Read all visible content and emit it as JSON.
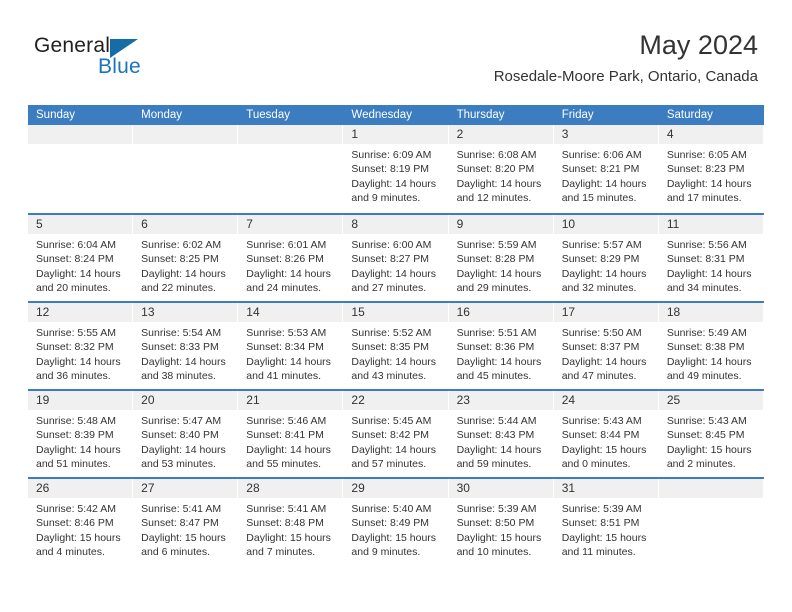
{
  "brand": {
    "name_part1": "General",
    "name_part2": "Blue",
    "accent_color": "#1b75bb",
    "triangle_color": "#166ca7"
  },
  "header": {
    "title": "May 2024",
    "subtitle": "Rosedale-Moore Park, Ontario, Canada"
  },
  "calendar": {
    "header_color": "#3b7dc0",
    "weekdays": [
      "Sunday",
      "Monday",
      "Tuesday",
      "Wednesday",
      "Thursday",
      "Friday",
      "Saturday"
    ],
    "weeks": [
      [
        {
          "day": "",
          "sunrise": "",
          "sunset": "",
          "daylight_line1": "",
          "daylight_line2": ""
        },
        {
          "day": "",
          "sunrise": "",
          "sunset": "",
          "daylight_line1": "",
          "daylight_line2": ""
        },
        {
          "day": "",
          "sunrise": "",
          "sunset": "",
          "daylight_line1": "",
          "daylight_line2": ""
        },
        {
          "day": "1",
          "sunrise": "Sunrise: 6:09 AM",
          "sunset": "Sunset: 8:19 PM",
          "daylight_line1": "Daylight: 14 hours",
          "daylight_line2": "and 9 minutes."
        },
        {
          "day": "2",
          "sunrise": "Sunrise: 6:08 AM",
          "sunset": "Sunset: 8:20 PM",
          "daylight_line1": "Daylight: 14 hours",
          "daylight_line2": "and 12 minutes."
        },
        {
          "day": "3",
          "sunrise": "Sunrise: 6:06 AM",
          "sunset": "Sunset: 8:21 PM",
          "daylight_line1": "Daylight: 14 hours",
          "daylight_line2": "and 15 minutes."
        },
        {
          "day": "4",
          "sunrise": "Sunrise: 6:05 AM",
          "sunset": "Sunset: 8:23 PM",
          "daylight_line1": "Daylight: 14 hours",
          "daylight_line2": "and 17 minutes."
        }
      ],
      [
        {
          "day": "5",
          "sunrise": "Sunrise: 6:04 AM",
          "sunset": "Sunset: 8:24 PM",
          "daylight_line1": "Daylight: 14 hours",
          "daylight_line2": "and 20 minutes."
        },
        {
          "day": "6",
          "sunrise": "Sunrise: 6:02 AM",
          "sunset": "Sunset: 8:25 PM",
          "daylight_line1": "Daylight: 14 hours",
          "daylight_line2": "and 22 minutes."
        },
        {
          "day": "7",
          "sunrise": "Sunrise: 6:01 AM",
          "sunset": "Sunset: 8:26 PM",
          "daylight_line1": "Daylight: 14 hours",
          "daylight_line2": "and 24 minutes."
        },
        {
          "day": "8",
          "sunrise": "Sunrise: 6:00 AM",
          "sunset": "Sunset: 8:27 PM",
          "daylight_line1": "Daylight: 14 hours",
          "daylight_line2": "and 27 minutes."
        },
        {
          "day": "9",
          "sunrise": "Sunrise: 5:59 AM",
          "sunset": "Sunset: 8:28 PM",
          "daylight_line1": "Daylight: 14 hours",
          "daylight_line2": "and 29 minutes."
        },
        {
          "day": "10",
          "sunrise": "Sunrise: 5:57 AM",
          "sunset": "Sunset: 8:29 PM",
          "daylight_line1": "Daylight: 14 hours",
          "daylight_line2": "and 32 minutes."
        },
        {
          "day": "11",
          "sunrise": "Sunrise: 5:56 AM",
          "sunset": "Sunset: 8:31 PM",
          "daylight_line1": "Daylight: 14 hours",
          "daylight_line2": "and 34 minutes."
        }
      ],
      [
        {
          "day": "12",
          "sunrise": "Sunrise: 5:55 AM",
          "sunset": "Sunset: 8:32 PM",
          "daylight_line1": "Daylight: 14 hours",
          "daylight_line2": "and 36 minutes."
        },
        {
          "day": "13",
          "sunrise": "Sunrise: 5:54 AM",
          "sunset": "Sunset: 8:33 PM",
          "daylight_line1": "Daylight: 14 hours",
          "daylight_line2": "and 38 minutes."
        },
        {
          "day": "14",
          "sunrise": "Sunrise: 5:53 AM",
          "sunset": "Sunset: 8:34 PM",
          "daylight_line1": "Daylight: 14 hours",
          "daylight_line2": "and 41 minutes."
        },
        {
          "day": "15",
          "sunrise": "Sunrise: 5:52 AM",
          "sunset": "Sunset: 8:35 PM",
          "daylight_line1": "Daylight: 14 hours",
          "daylight_line2": "and 43 minutes."
        },
        {
          "day": "16",
          "sunrise": "Sunrise: 5:51 AM",
          "sunset": "Sunset: 8:36 PM",
          "daylight_line1": "Daylight: 14 hours",
          "daylight_line2": "and 45 minutes."
        },
        {
          "day": "17",
          "sunrise": "Sunrise: 5:50 AM",
          "sunset": "Sunset: 8:37 PM",
          "daylight_line1": "Daylight: 14 hours",
          "daylight_line2": "and 47 minutes."
        },
        {
          "day": "18",
          "sunrise": "Sunrise: 5:49 AM",
          "sunset": "Sunset: 8:38 PM",
          "daylight_line1": "Daylight: 14 hours",
          "daylight_line2": "and 49 minutes."
        }
      ],
      [
        {
          "day": "19",
          "sunrise": "Sunrise: 5:48 AM",
          "sunset": "Sunset: 8:39 PM",
          "daylight_line1": "Daylight: 14 hours",
          "daylight_line2": "and 51 minutes."
        },
        {
          "day": "20",
          "sunrise": "Sunrise: 5:47 AM",
          "sunset": "Sunset: 8:40 PM",
          "daylight_line1": "Daylight: 14 hours",
          "daylight_line2": "and 53 minutes."
        },
        {
          "day": "21",
          "sunrise": "Sunrise: 5:46 AM",
          "sunset": "Sunset: 8:41 PM",
          "daylight_line1": "Daylight: 14 hours",
          "daylight_line2": "and 55 minutes."
        },
        {
          "day": "22",
          "sunrise": "Sunrise: 5:45 AM",
          "sunset": "Sunset: 8:42 PM",
          "daylight_line1": "Daylight: 14 hours",
          "daylight_line2": "and 57 minutes."
        },
        {
          "day": "23",
          "sunrise": "Sunrise: 5:44 AM",
          "sunset": "Sunset: 8:43 PM",
          "daylight_line1": "Daylight: 14 hours",
          "daylight_line2": "and 59 minutes."
        },
        {
          "day": "24",
          "sunrise": "Sunrise: 5:43 AM",
          "sunset": "Sunset: 8:44 PM",
          "daylight_line1": "Daylight: 15 hours",
          "daylight_line2": "and 0 minutes."
        },
        {
          "day": "25",
          "sunrise": "Sunrise: 5:43 AM",
          "sunset": "Sunset: 8:45 PM",
          "daylight_line1": "Daylight: 15 hours",
          "daylight_line2": "and 2 minutes."
        }
      ],
      [
        {
          "day": "26",
          "sunrise": "Sunrise: 5:42 AM",
          "sunset": "Sunset: 8:46 PM",
          "daylight_line1": "Daylight: 15 hours",
          "daylight_line2": "and 4 minutes."
        },
        {
          "day": "27",
          "sunrise": "Sunrise: 5:41 AM",
          "sunset": "Sunset: 8:47 PM",
          "daylight_line1": "Daylight: 15 hours",
          "daylight_line2": "and 6 minutes."
        },
        {
          "day": "28",
          "sunrise": "Sunrise: 5:41 AM",
          "sunset": "Sunset: 8:48 PM",
          "daylight_line1": "Daylight: 15 hours",
          "daylight_line2": "and 7 minutes."
        },
        {
          "day": "29",
          "sunrise": "Sunrise: 5:40 AM",
          "sunset": "Sunset: 8:49 PM",
          "daylight_line1": "Daylight: 15 hours",
          "daylight_line2": "and 9 minutes."
        },
        {
          "day": "30",
          "sunrise": "Sunrise: 5:39 AM",
          "sunset": "Sunset: 8:50 PM",
          "daylight_line1": "Daylight: 15 hours",
          "daylight_line2": "and 10 minutes."
        },
        {
          "day": "31",
          "sunrise": "Sunrise: 5:39 AM",
          "sunset": "Sunset: 8:51 PM",
          "daylight_line1": "Daylight: 15 hours",
          "daylight_line2": "and 11 minutes."
        },
        {
          "day": "",
          "sunrise": "",
          "sunset": "",
          "daylight_line1": "",
          "daylight_line2": ""
        }
      ]
    ]
  }
}
